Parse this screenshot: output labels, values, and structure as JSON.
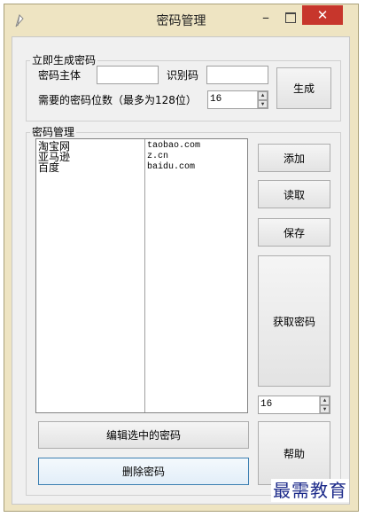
{
  "window": {
    "title": "密码管理",
    "min_glyph": "–",
    "close_glyph": "✕"
  },
  "generate": {
    "group_title": "立即生成密码",
    "subject_label": "密码主体",
    "subject_value": "",
    "id_label": "识别码",
    "id_value": "",
    "length_label": "需要的密码位数（最多为128位）",
    "length_value": "16",
    "generate_button": "生成"
  },
  "manage": {
    "group_title": "密码管理",
    "rows": [
      {
        "name": "淘宝网",
        "site": "taobao.com"
      },
      {
        "name": "亚马逊",
        "site": "z.cn"
      },
      {
        "name": "百度",
        "site": "baidu.com"
      }
    ],
    "add_button": "添加",
    "read_button": "读取",
    "save_button": "保存",
    "get_password_button": "获取密码",
    "get_length_value": "16",
    "edit_button": "编辑选中的密码",
    "delete_button": "删除密码",
    "help_button": "帮助"
  },
  "watermark": "最需教育",
  "icons": {
    "app": "key-feather-icon",
    "spin_up": "▲",
    "spin_down": "▼"
  },
  "colors": {
    "frame": "#eee4c2",
    "client": "#f0f0f0",
    "close": "#c7362c",
    "watermark": "#1c2a8a"
  }
}
